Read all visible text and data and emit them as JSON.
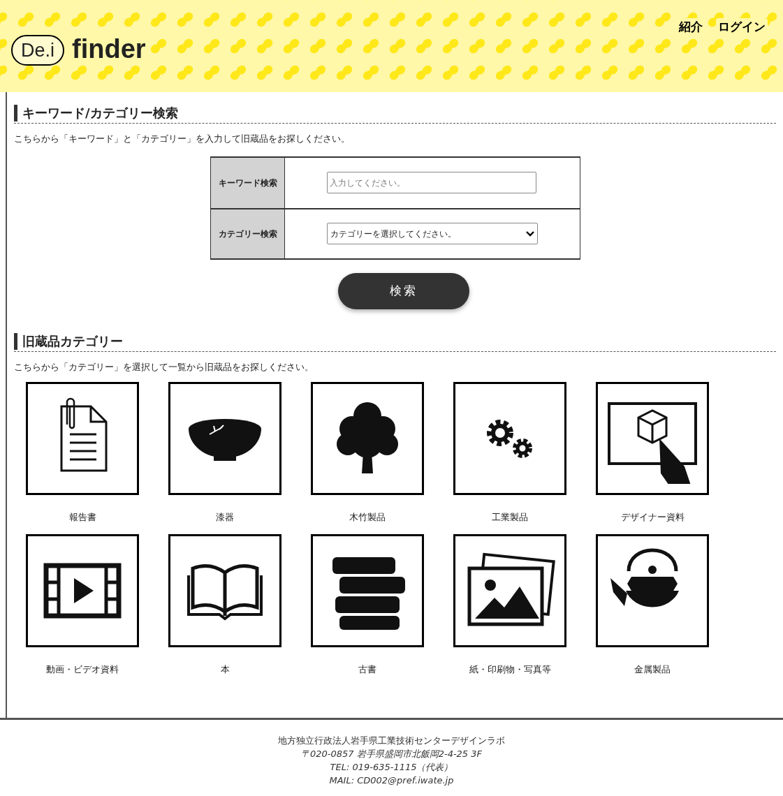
{
  "header": {
    "logo": {
      "mark": "De.i",
      "word": "finder"
    },
    "nav": [
      "紹介",
      "ログイン"
    ]
  },
  "search_section": {
    "title": "キーワード/カテゴリー検索",
    "description": "こちらから「キーワード」と「カテゴリー」を入力して旧蔵品をお探しください。",
    "fields": [
      {
        "label": "キーワード検索",
        "kind": "text",
        "placeholder": "入力してください。"
      },
      {
        "label": "カテゴリー検索",
        "kind": "select",
        "value": "カテゴリーを選択してください。"
      }
    ],
    "button": "検索"
  },
  "category_section": {
    "title": "旧蔵品カテゴリー",
    "description": "こちらから「カテゴリー」を選択して一覧から旧蔵品をお探しください。",
    "categories": [
      {
        "label": "報告書"
      },
      {
        "label": "漆器"
      },
      {
        "label": "木竹製品"
      },
      {
        "label": "工業製品"
      },
      {
        "label": "デザイナー資料"
      },
      {
        "label": "動画・ビデオ資料"
      },
      {
        "label": "本"
      },
      {
        "label": "古書"
      },
      {
        "label": "紙・印刷物・写真等"
      },
      {
        "label": "金属製品"
      }
    ]
  },
  "footer": [
    "地方独立行政法人岩手県工業技術センターデザインラボ",
    "〒020-0857 岩手県盛岡市北飯岡2-4-25 3F",
    "TEL: 019-635-1115（代表）",
    "MAIL: CD002@pref.iwate.jp"
  ]
}
